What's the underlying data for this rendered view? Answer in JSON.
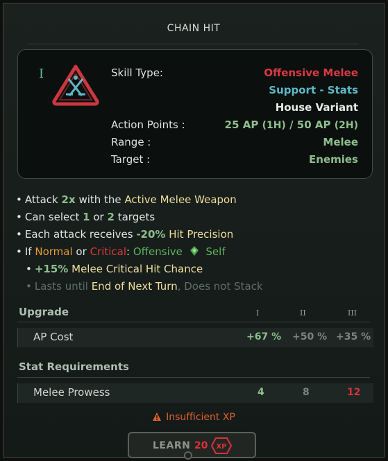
{
  "title": "CHAIN HIT",
  "skill": {
    "tier": "I",
    "icon": "crossed-swords-triangle-icon",
    "skill_type_label": "Skill Type:",
    "skill_type_value": "Offensive Melee",
    "category": "Support - Stats",
    "variant": "House Variant",
    "ap_label": "Action Points :",
    "ap_1h": "25 AP",
    "ap_1h_tag": "(1H)",
    "ap_sep": "/",
    "ap_2h": "50 AP",
    "ap_2h_tag": "(2H)",
    "range_label": "Range :",
    "range_value": "Melee",
    "target_label": "Target :",
    "target_value": "Enemies"
  },
  "effects": {
    "attack": {
      "pre": "Attack",
      "count": "2x",
      "mid": "with the",
      "weapon": "Active Melee Weapon"
    },
    "select": {
      "pre": "Can select",
      "a": "1",
      "or": "or",
      "b": "2",
      "post": "targets"
    },
    "each": {
      "pre": "Each attack receives",
      "val": "-20%",
      "post": "Hit Precision"
    },
    "if": {
      "pre": "If",
      "normal": "Normal",
      "or": "or",
      "critical": "Critical",
      "colon": ":",
      "offensive": "Offensive",
      "self": "Self"
    },
    "crit": {
      "val": "+15%",
      "post": "Melee Critical Hit Chance"
    },
    "lasts": {
      "pre": "Lasts until",
      "until": "End of Next Turn",
      "post": ", Does not Stack"
    }
  },
  "upgrade": {
    "heading": "Upgrade",
    "tiers": [
      "I",
      "II",
      "III"
    ],
    "row_label": "AP Cost",
    "values": [
      "+67 %",
      "+50 %",
      "+35 %"
    ]
  },
  "requirements": {
    "heading": "Stat Requirements",
    "row_label": "Melee Prowess",
    "values": [
      "4",
      "8",
      "12"
    ]
  },
  "warning": "Insufficient XP",
  "learn": {
    "label": "LEARN",
    "cost": "20",
    "unit": "XP"
  },
  "colors": {
    "offensive": "#d93a43",
    "support": "#5db8c6",
    "positive": "#8dbf8d",
    "highlight": "#eedf9e",
    "warning": "#e0602f"
  }
}
